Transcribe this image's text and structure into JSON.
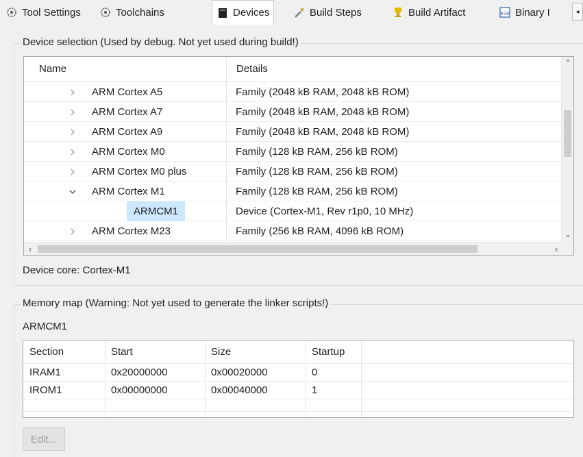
{
  "tabs": [
    {
      "label": "Tool Settings",
      "icon": "tool-settings-icon",
      "active": false
    },
    {
      "label": "Toolchains",
      "icon": "toolchains-icon",
      "active": false
    },
    {
      "label": "Devices",
      "icon": "devices-icon",
      "active": true
    },
    {
      "label": "Build Steps",
      "icon": "build-steps-icon",
      "active": false
    },
    {
      "label": "Build Artifact",
      "icon": "build-artifact-icon",
      "active": false
    },
    {
      "label": "Binary I",
      "icon": "binary-icon",
      "active": false
    }
  ],
  "device_selection": {
    "title": "Device selection (Used by debug. Not yet used during build!)",
    "columns": [
      "Name",
      "Details"
    ],
    "rows": [
      {
        "expander": ">",
        "name": "ARM Cortex A5",
        "details": "Family (2048 kB RAM, 2048 kB ROM)"
      },
      {
        "expander": ">",
        "name": "ARM Cortex A7",
        "details": "Family (2048 kB RAM, 2048 kB ROM)"
      },
      {
        "expander": ">",
        "name": "ARM Cortex A9",
        "details": "Family (2048 kB RAM, 2048 kB ROM)"
      },
      {
        "expander": ">",
        "name": "ARM Cortex M0",
        "details": "Family (128 kB RAM, 256 kB ROM)"
      },
      {
        "expander": ">",
        "name": "ARM Cortex M0 plus",
        "details": "Family (128 kB RAM, 256 kB ROM)"
      },
      {
        "expander": "v",
        "name": "ARM Cortex M1",
        "details": "Family (128 kB RAM, 256 kB ROM)"
      },
      {
        "expander": "",
        "name": "ARMCM1",
        "details": "Device (Cortex-M1, Rev r1p0, 10 MHz)",
        "selected": true
      },
      {
        "expander": ">",
        "name": "ARM Cortex M23",
        "details": "Family (256 kB RAM, 4096 kB ROM)"
      }
    ],
    "device_core": "Device core: Cortex-M1"
  },
  "memory_map": {
    "title": "Memory map (Warning: Not yet used to generate the linker scripts!)",
    "device": "ARMCM1",
    "columns": [
      "Section",
      "Start",
      "Size",
      "Startup"
    ],
    "rows": [
      {
        "section": "IRAM1",
        "start": "0x20000000",
        "size": "0x00020000",
        "startup": "0"
      },
      {
        "section": "IROM1",
        "start": "0x00000000",
        "size": "0x00040000",
        "startup": "1"
      }
    ],
    "edit_label": "Edit..."
  },
  "colors": {
    "selection": "#cce8ff",
    "background": "#f0f0f0"
  }
}
